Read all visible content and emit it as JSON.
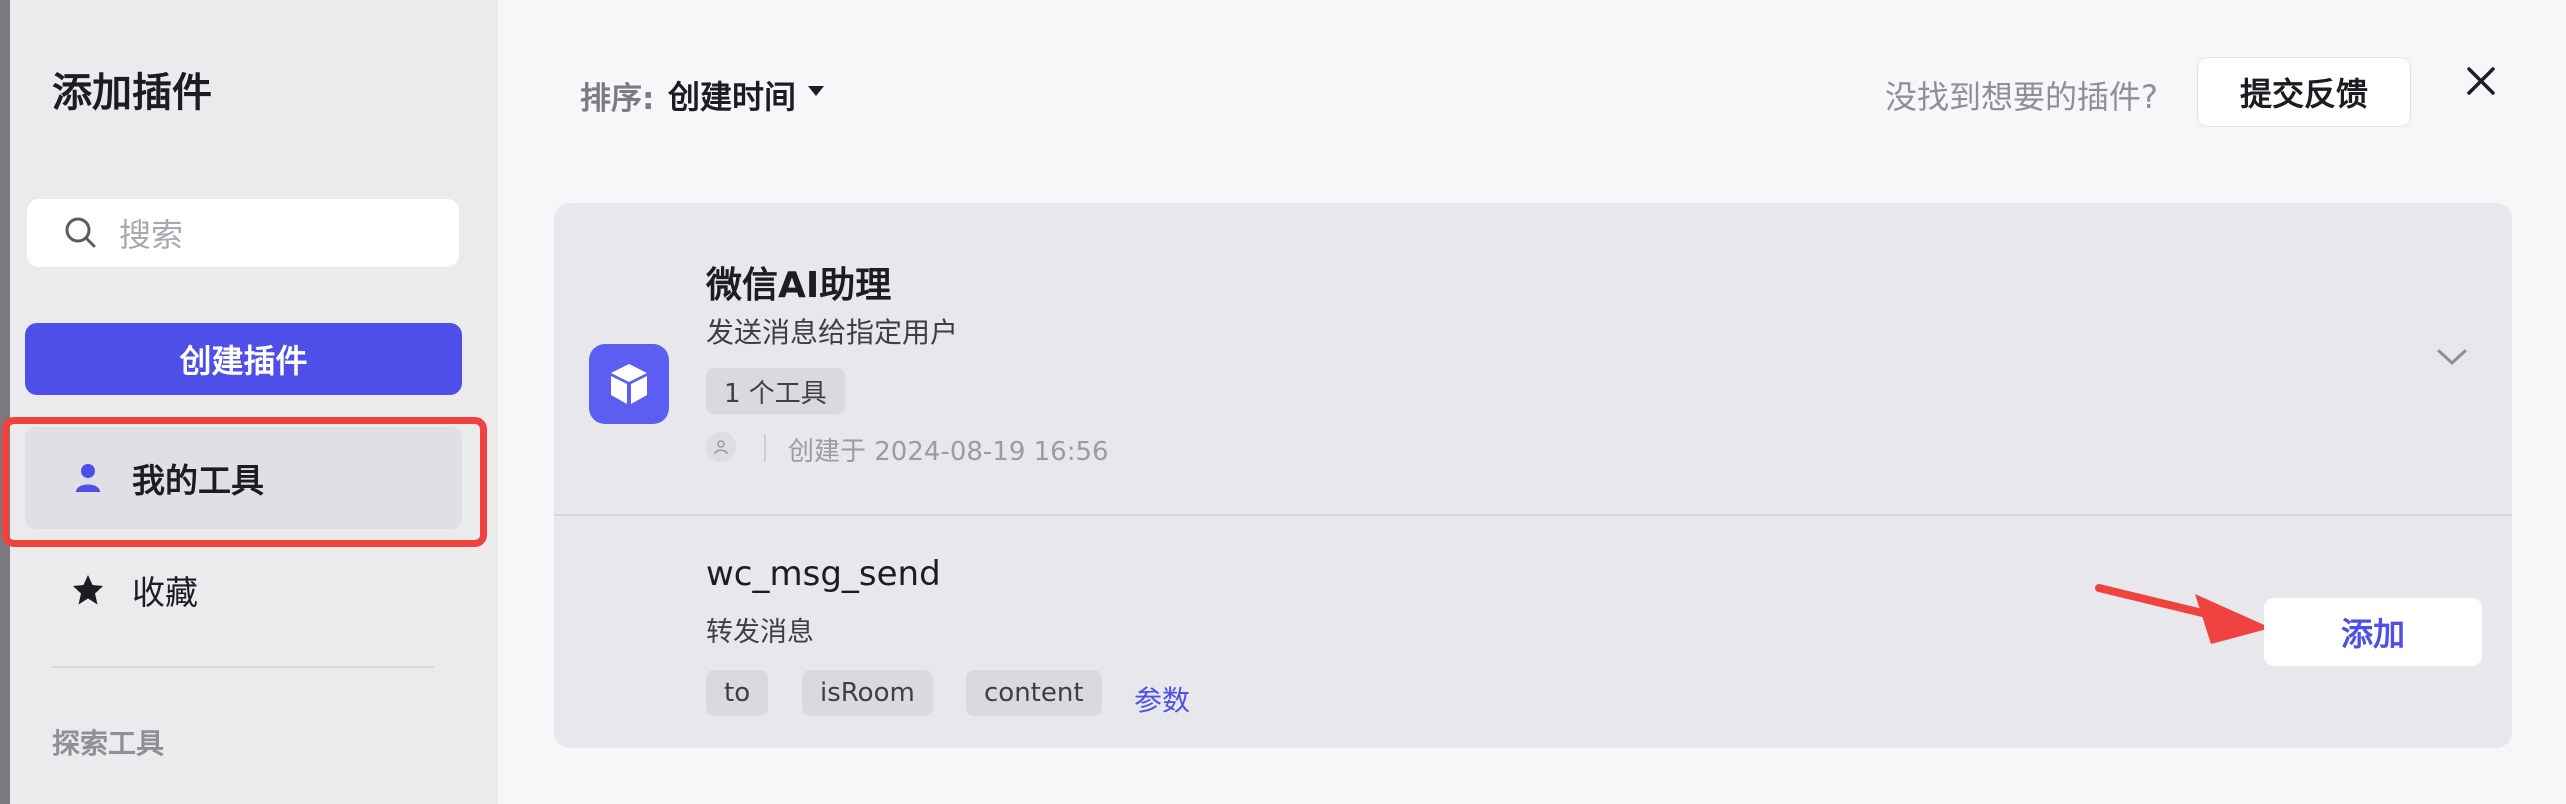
{
  "sidebar": {
    "title": "添加插件",
    "search_placeholder": "搜索",
    "create_button": "创建插件",
    "nav": [
      {
        "label": "我的工具",
        "icon": "user-icon",
        "selected": true
      },
      {
        "label": "收藏",
        "icon": "star-icon",
        "selected": false
      }
    ],
    "explore_heading": "探索工具"
  },
  "header": {
    "sort_label": "排序:",
    "sort_value": "创建时间",
    "not_found_text": "没找到想要的插件?",
    "feedback_button": "提交反馈"
  },
  "plugin": {
    "name": "微信AI助理",
    "description": "发送消息给指定用户",
    "tool_count": "1 个工具",
    "created": "创建于 2024-08-19 16:56",
    "icon": "cube-icon",
    "tools": [
      {
        "name": "wc_msg_send",
        "description": "转发消息",
        "params": [
          "to",
          "isRoom",
          "content"
        ],
        "params_link": "参数",
        "add_button": "添加"
      }
    ]
  },
  "colors": {
    "accent": "#4e4fe8",
    "highlight_outline": "#f0433f",
    "sidebar_bg": "#ebebee",
    "card_bg": "#e8e8ec"
  }
}
